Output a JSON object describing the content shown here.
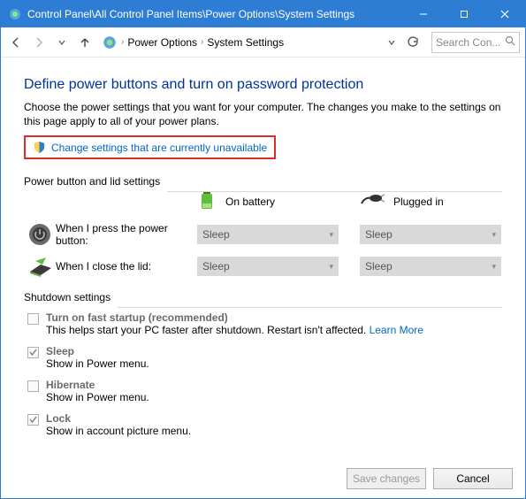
{
  "titlebar": {
    "title": "Control Panel\\All Control Panel Items\\Power Options\\System Settings"
  },
  "breadcrumb": {
    "item1": "Power Options",
    "item2": "System Settings"
  },
  "search": {
    "placeholder": "Search Con..."
  },
  "heading": "Define power buttons and turn on password protection",
  "description": "Choose the power settings that you want for your computer. The changes you make to the settings on this page apply to all of your power plans.",
  "change_link": "Change settings that are currently unavailable",
  "section1_title": "Power button and lid settings",
  "col_battery": "On battery",
  "col_plugged": "Plugged in",
  "row1_label": "When I press the power button:",
  "row2_label": "When I close the lid:",
  "combo_value": "Sleep",
  "section2_title": "Shutdown settings",
  "shutdown": [
    {
      "label": "Turn on fast startup (recommended)",
      "sub_before": "This helps start your PC faster after shutdown. Restart isn't affected. ",
      "learn": "Learn More",
      "checked": false
    },
    {
      "label": "Sleep",
      "sub": "Show in Power menu.",
      "checked": true
    },
    {
      "label": "Hibernate",
      "sub": "Show in Power menu.",
      "checked": false
    },
    {
      "label": "Lock",
      "sub": "Show in account picture menu.",
      "checked": true
    }
  ],
  "buttons": {
    "save": "Save changes",
    "cancel": "Cancel"
  }
}
